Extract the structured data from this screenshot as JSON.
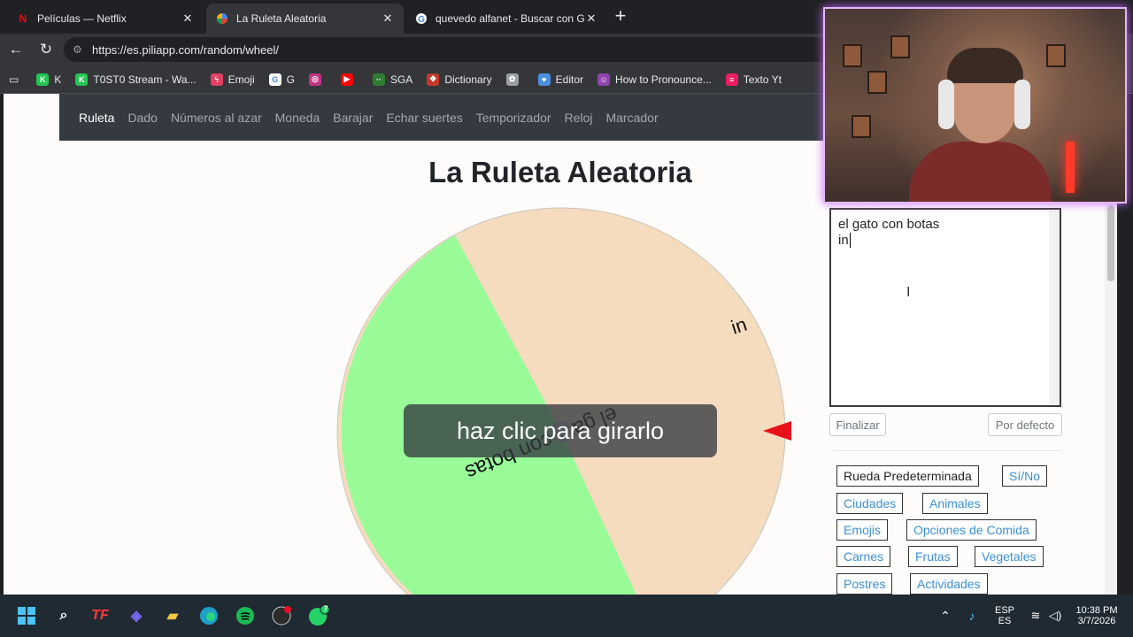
{
  "browser": {
    "tabs": [
      {
        "title": "Películas — Netflix",
        "icon": "netflix-icon"
      },
      {
        "title": "La Ruleta Aleatoria",
        "icon": "piliapp-icon"
      },
      {
        "title": "quevedo alfanet - Buscar con Goo",
        "icon": "google-icon"
      }
    ],
    "new_tab": "+",
    "url": "https://es.piliapp.com/random/wheel/",
    "bookmarks": [
      {
        "label": "K",
        "color": "#23c552"
      },
      {
        "label": "T0ST0 Stream - Wa...",
        "color": "#23c552"
      },
      {
        "label": "Emoji",
        "color": "#e4405f"
      },
      {
        "label": "G",
        "color": "#4285f4"
      },
      {
        "label": "",
        "color": "#c13584"
      },
      {
        "label": "",
        "color": "#ff0000"
      },
      {
        "label": "SGA",
        "color": "#2e7d32"
      },
      {
        "label": "Dictionary",
        "color": "#c0392b"
      },
      {
        "label": "",
        "color": "#9aa0a6"
      },
      {
        "label": "Editor",
        "color": "#4a90e2"
      },
      {
        "label": "How to Pronounce...",
        "color": "#8e44ad"
      },
      {
        "label": "Texto Yt",
        "color": "#e91e63"
      }
    ]
  },
  "site": {
    "nav": [
      "Ruleta",
      "Dado",
      "Números al azar",
      "Moneda",
      "Barajar",
      "Echar suertes",
      "Temporizador",
      "Reloj",
      "Marcador"
    ],
    "active_nav": "Ruleta",
    "title": "La Ruleta Aleatoria",
    "wheel": {
      "entries": [
        "el gato con botas",
        "in"
      ],
      "colors": [
        "#98fb98",
        "#f5dcbe"
      ],
      "pointer_color": "#e8101a"
    },
    "spin_button": "haz clic para girarlo",
    "editor_lines": [
      "el gato con botas",
      "in"
    ],
    "finish_button": "Finalizar",
    "default_button": "Por defecto",
    "presets": [
      "Rueda Predeterminada",
      "Sí/No",
      "Ciudades",
      "Animales",
      "Emojis",
      "Opciones de Comida",
      "Carnes",
      "Frutas",
      "Vegetales",
      "Postres",
      "Actividades"
    ]
  },
  "taskbar": {
    "language_top": "ESP",
    "language_bottom": "ES",
    "time": "10:38 PM",
    "date": "3/7/2026",
    "whatsapp_badge": "7"
  }
}
